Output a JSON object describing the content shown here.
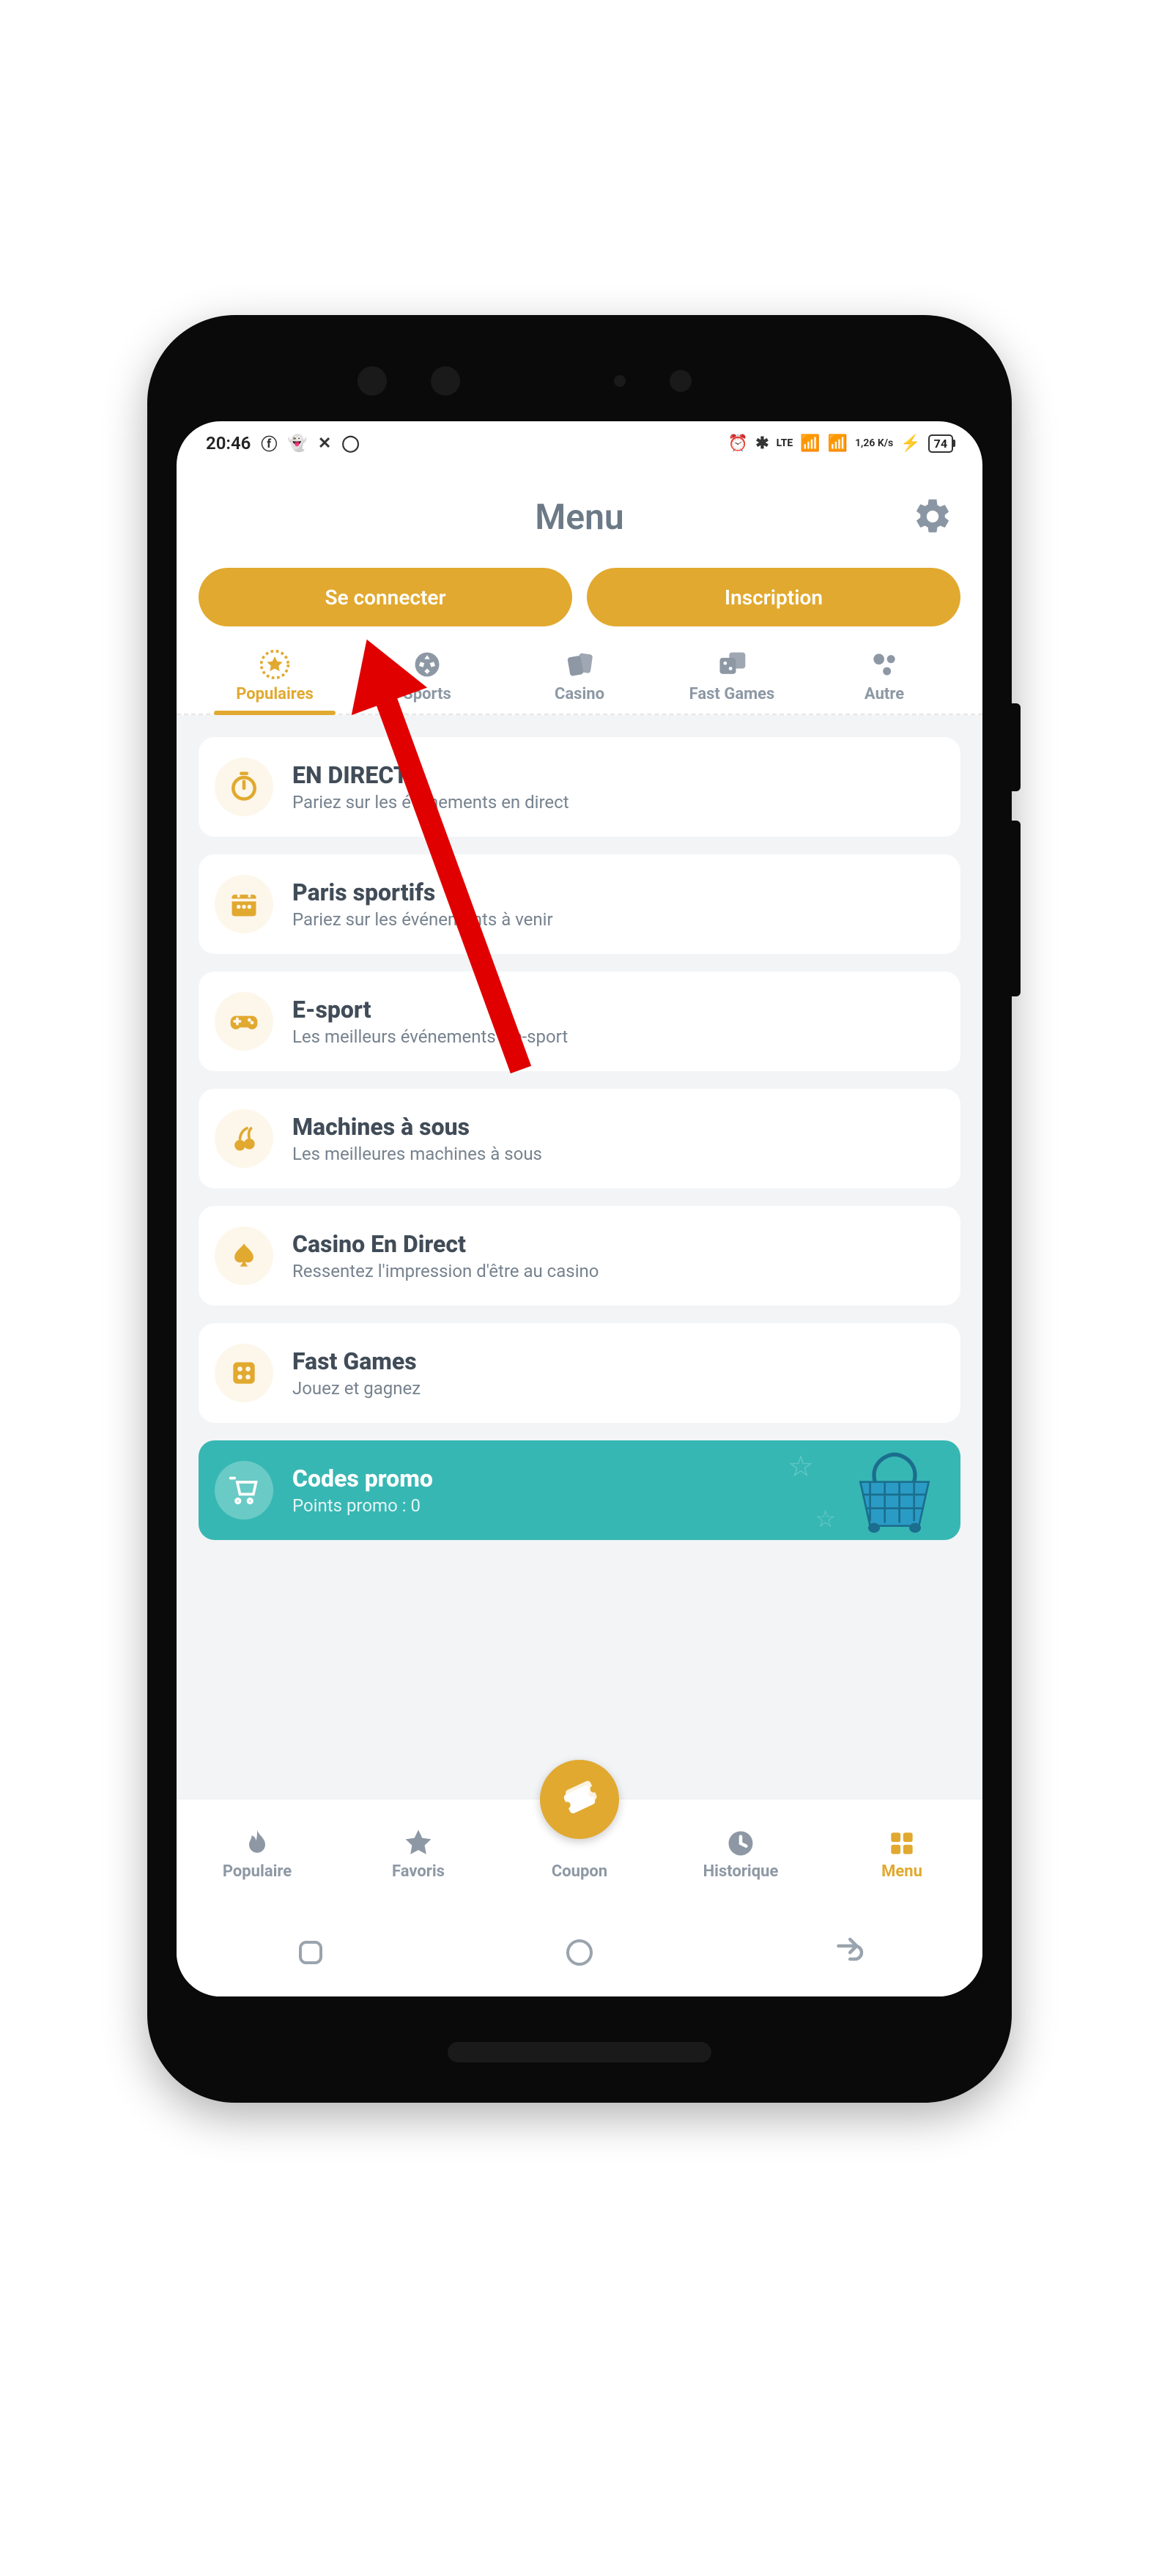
{
  "status_bar": {
    "time": "20:46",
    "battery": "74",
    "network_rate": "1,26 K/s",
    "lte_label": "LTE"
  },
  "header": {
    "title": "Menu"
  },
  "auth": {
    "login": "Se connecter",
    "register": "Inscription"
  },
  "category_tabs": [
    {
      "label": "Populaires"
    },
    {
      "label": "Sports"
    },
    {
      "label": "Casino"
    },
    {
      "label": "Fast Games"
    },
    {
      "label": "Autre"
    }
  ],
  "menu_items": [
    {
      "title": "EN DIRECT",
      "subtitle": "Pariez sur les événements en direct"
    },
    {
      "title": "Paris sportifs",
      "subtitle": "Pariez sur les événements à venir"
    },
    {
      "title": "E-sport",
      "subtitle": "Les meilleurs événements d'e-sport"
    },
    {
      "title": "Machines à sous",
      "subtitle": "Les meilleures machines à sous"
    },
    {
      "title": "Casino En Direct",
      "subtitle": "Ressentez l'impression d'être au casino"
    },
    {
      "title": "Fast Games",
      "subtitle": "Jouez et gagnez"
    }
  ],
  "promo": {
    "title": "Codes promo",
    "subtitle": "Points promo : 0"
  },
  "bottom_nav": [
    {
      "label": "Populaire"
    },
    {
      "label": "Favoris"
    },
    {
      "label": "Coupon"
    },
    {
      "label": "Historique"
    },
    {
      "label": "Menu"
    }
  ]
}
